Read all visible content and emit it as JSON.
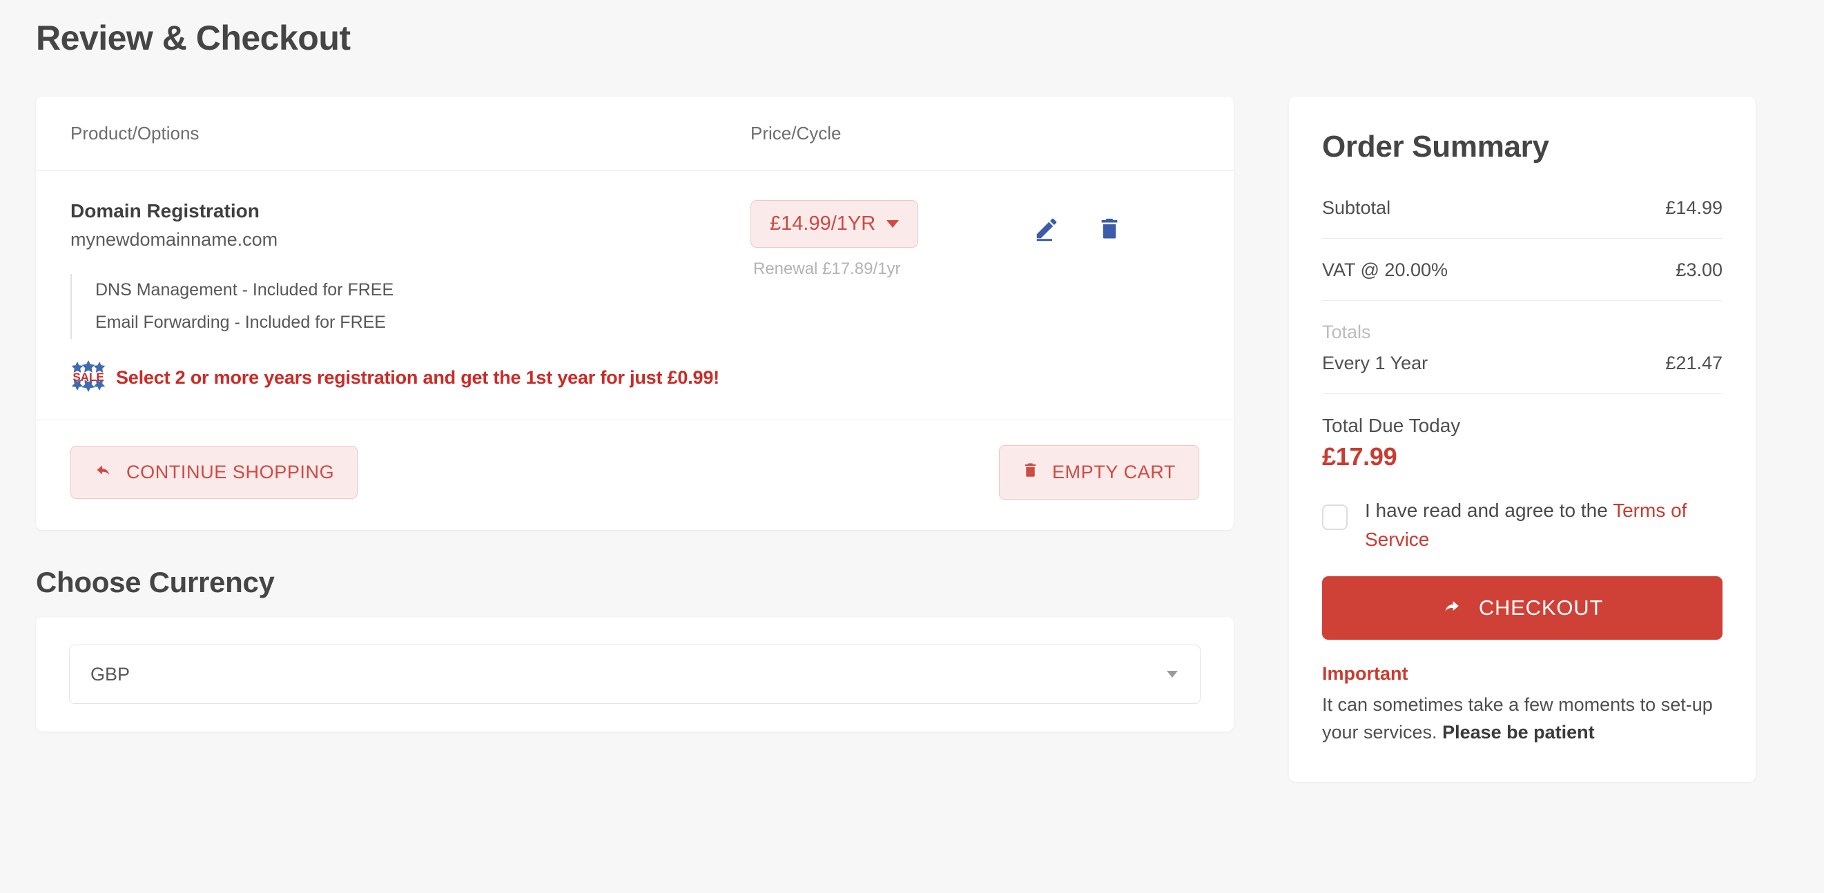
{
  "page": {
    "title": "Review & Checkout",
    "currency_section_title": "Choose Currency"
  },
  "cart": {
    "headers": {
      "product": "Product/Options",
      "price": "Price/Cycle"
    },
    "item": {
      "name": "Domain Registration",
      "domain": "mynewdomainname.com",
      "features": [
        "DNS Management - Included for FREE",
        "Email Forwarding - Included for FREE"
      ],
      "price_label": "£14.99/1YR",
      "renewal": "Renewal £17.89/1yr",
      "edit_icon": "pencil-icon",
      "delete_icon": "trash-icon"
    },
    "promo": {
      "badge": "SALE",
      "text": "Select 2 or more years registration and get the 1st year for just £0.99!"
    },
    "buttons": {
      "continue_shopping": "CONTINUE SHOPPING",
      "empty_cart": "EMPTY CART"
    }
  },
  "currency": {
    "selected": "GBP"
  },
  "summary": {
    "title": "Order Summary",
    "rows": [
      {
        "label": "Subtotal",
        "value": "£14.99"
      },
      {
        "label": "VAT @ 20.00%",
        "value": "£3.00"
      }
    ],
    "totals_label": "Totals",
    "recurring": {
      "label": "Every 1 Year",
      "value": "£21.47"
    },
    "due_label": "Total Due Today",
    "due_amount": "£17.99",
    "agree_text": "I have read and agree to the ",
    "tos_link": "Terms of Service",
    "checkout_label": "CHECKOUT",
    "important_label": "Important",
    "important_text": "It can sometimes take a few moments to set-up your services. ",
    "important_bold": "Please be patient"
  },
  "colors": {
    "accent_red": "#cf4137",
    "link_red": "#cc3a2f",
    "pill_bg": "#fbeaea",
    "icon_blue": "#3b5ca8",
    "page_bg": "#f7f7f7"
  }
}
